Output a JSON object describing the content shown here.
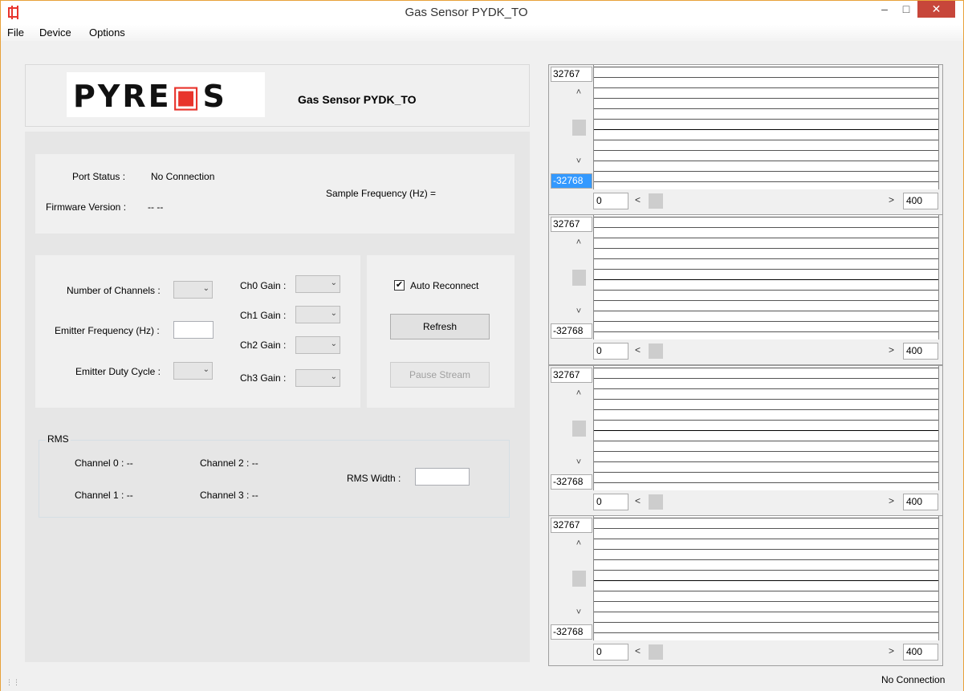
{
  "window": {
    "title": "Gas Sensor PYDK_TO"
  },
  "menu": [
    "File",
    "Device",
    "Options"
  ],
  "header": {
    "logo_text": "PYREOS",
    "title": "Gas Sensor PYDK_TO"
  },
  "status_panel": {
    "port_status_label": "Port Status :",
    "port_status_value": "No Connection",
    "firmware_label": "Firmware Version :",
    "firmware_value": "-- --",
    "sample_freq_label": "Sample Frequency (Hz) ="
  },
  "config": {
    "num_channels_label": "Number of Channels :",
    "emitter_freq_label": "Emitter Frequency (Hz) :",
    "emitter_duty_label": "Emitter Duty Cycle :",
    "ch0_gain": "Ch0 Gain :",
    "ch1_gain": "Ch1 Gain :",
    "ch2_gain": "Ch2 Gain :",
    "ch3_gain": "Ch3 Gain :"
  },
  "controls": {
    "auto_reconnect_label": "Auto Reconnect",
    "auto_reconnect_checked": true,
    "refresh_label": "Refresh",
    "pause_label": "Pause Stream"
  },
  "rms": {
    "group_title": "RMS",
    "ch0": "Channel 0 : --",
    "ch1": "Channel 1 : --",
    "ch2": "Channel 2 : --",
    "ch3": "Channel 3 : --",
    "width_label": "RMS Width :"
  },
  "charts": [
    {
      "y_max": "32767",
      "y_min": "-32768",
      "x_min": "0",
      "x_max": "400"
    },
    {
      "y_max": "32767",
      "y_min": "-32768",
      "x_min": "0",
      "x_max": "400"
    },
    {
      "y_max": "32767",
      "y_min": "-32768",
      "x_min": "0",
      "x_max": "400"
    },
    {
      "y_max": "32767",
      "y_min": "-32768",
      "x_min": "0",
      "x_max": "400"
    }
  ],
  "status_bar": {
    "text": "No Connection"
  },
  "colors": {
    "accent": "#e8342c",
    "selection": "#3399ff",
    "close_button": "#c7463a"
  }
}
